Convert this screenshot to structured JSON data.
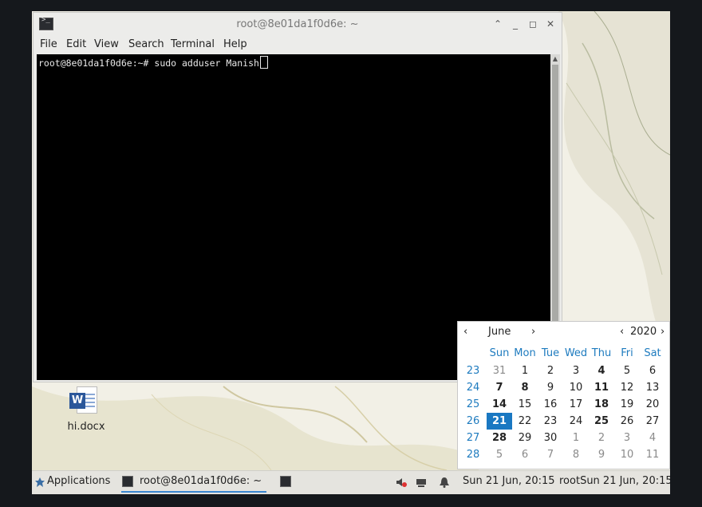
{
  "terminal": {
    "title": "root@8e01da1f0d6e: ~",
    "icon": "terminal-icon",
    "menu": [
      "File",
      "Edit",
      "View",
      "Search",
      "Terminal",
      "Help"
    ],
    "line": "root@8e01da1f0d6e:~# sudo adduser Manish"
  },
  "desktop": {
    "file_label": "hi.docx",
    "file_icon": "word-document-icon"
  },
  "calendar": {
    "month": "June",
    "year": "2020",
    "prev": "‹",
    "next": "›",
    "weekdays": [
      "Sun",
      "Mon",
      "Tue",
      "Wed",
      "Thu",
      "Fri",
      "Sat"
    ],
    "weeks": [
      {
        "num": "23",
        "days": [
          "31",
          "1",
          "2",
          "3",
          "4",
          "5",
          "6"
        ]
      },
      {
        "num": "24",
        "days": [
          "7",
          "8",
          "9",
          "10",
          "11",
          "12",
          "13"
        ]
      },
      {
        "num": "25",
        "days": [
          "14",
          "15",
          "16",
          "17",
          "18",
          "19",
          "20"
        ]
      },
      {
        "num": "26",
        "days": [
          "21",
          "22",
          "23",
          "24",
          "25",
          "26",
          "27"
        ]
      },
      {
        "num": "27",
        "days": [
          "28",
          "29",
          "30",
          "1",
          "2",
          "3",
          "4"
        ]
      },
      {
        "num": "28",
        "days": [
          "5",
          "6",
          "7",
          "8",
          "9",
          "10",
          "11"
        ]
      }
    ],
    "selected": "21",
    "accent": "#1a78c2"
  },
  "taskbar": {
    "applications": "Applications",
    "task_title": "root@8e01da1f0d6e: ~",
    "clock": "Sun 21 Jun, 20:15",
    "user_clock": "rootSun 21 Jun, 20:15"
  }
}
